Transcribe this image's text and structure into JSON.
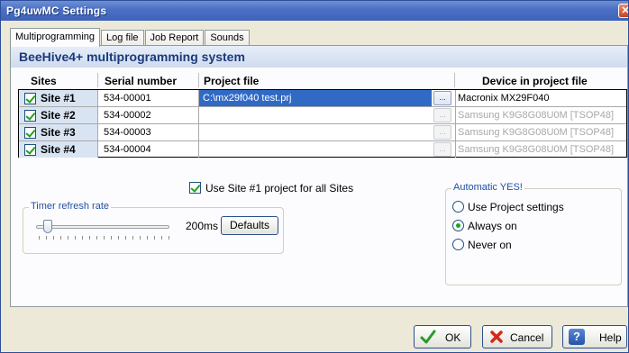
{
  "window": {
    "title": "Pg4uwMC Settings",
    "close_glyph": "✕"
  },
  "tabs": [
    {
      "label": "Multiprogramming",
      "active": true
    },
    {
      "label": "Log file"
    },
    {
      "label": "Job Report"
    },
    {
      "label": "Sounds"
    }
  ],
  "heading": "BeeHive4+ multiprogramming system",
  "grid": {
    "columns": {
      "sites": "Sites",
      "serial": "Serial number",
      "project": "Project file",
      "device": "Device in project file"
    },
    "rows": [
      {
        "site": "Site #1",
        "checked": true,
        "serial": "534-00001",
        "project": "C:\\mx29f040 test.prj",
        "device": "Macronix MX29F040",
        "selected": true
      },
      {
        "site": "Site #2",
        "checked": true,
        "serial": "534-00002",
        "project": "",
        "device": "Samsung K9G8G08U0M [TSOP48]"
      },
      {
        "site": "Site #3",
        "checked": true,
        "serial": "534-00003",
        "project": "",
        "device": "Samsung K9G8G08U0M [TSOP48]"
      },
      {
        "site": "Site #4",
        "checked": true,
        "serial": "534-00004",
        "project": "",
        "device": "Samsung K9G8G08U0M [TSOP48]"
      }
    ],
    "browse_label": "..."
  },
  "use_site1": {
    "label": "Use Site #1 project for all Sites",
    "checked": true
  },
  "timer": {
    "legend": "Timer refresh rate",
    "value": "200ms",
    "defaults_label": "Defaults"
  },
  "automatic_yes": {
    "legend": "Automatic YES!",
    "options": [
      {
        "label": "Use Project settings",
        "checked": false
      },
      {
        "label": "Always on",
        "checked": true
      },
      {
        "label": "Never on",
        "checked": false
      }
    ]
  },
  "buttons": {
    "ok": "OK",
    "cancel": "Cancel",
    "help": "Help"
  },
  "colors": {
    "accent": "#316ac5",
    "check_green": "#21a121",
    "heading": "#1c3a7a"
  }
}
